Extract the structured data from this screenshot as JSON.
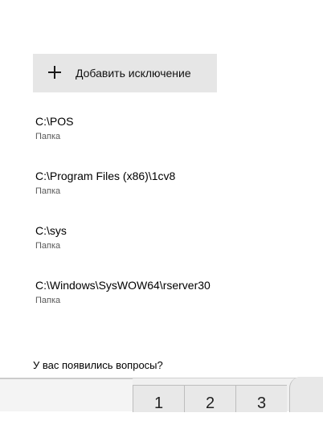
{
  "add_exclusion": {
    "icon": "plus-icon",
    "label": "Добавить исключение"
  },
  "exclusions": [
    {
      "path": "C:\\POS",
      "type": "Папка"
    },
    {
      "path": "C:\\Program Files (x86)\\1cv8",
      "type": "Папка"
    },
    {
      "path": "C:\\sys",
      "type": "Папка"
    },
    {
      "path": "C:\\Windows\\SysWOW64\\rserver30",
      "type": "Папка"
    }
  ],
  "help": {
    "questions": "У вас появились вопросы?"
  },
  "keypad": {
    "keys": [
      "1",
      "2",
      "3"
    ]
  },
  "colors": {
    "button_bg": "#e6e6e6",
    "secondary_text": "#5a5a5a",
    "link": "#0067c0"
  }
}
